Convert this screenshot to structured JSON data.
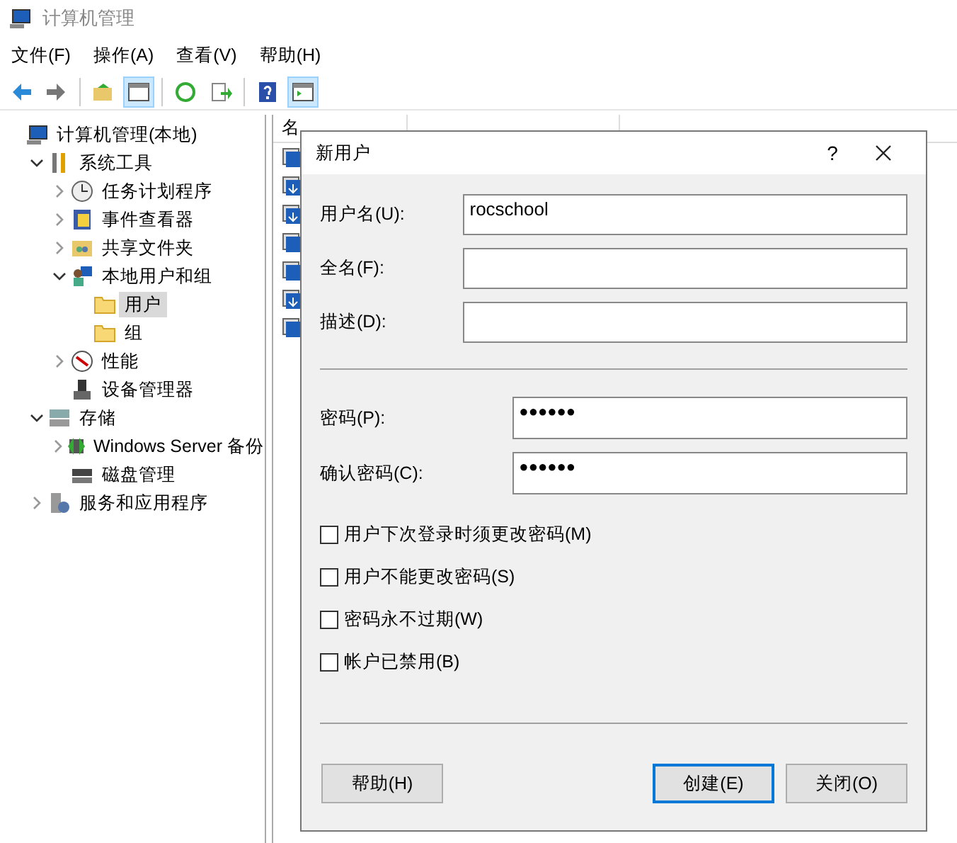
{
  "window": {
    "title": "计算机管理"
  },
  "menu": [
    "文件(F)",
    "操作(A)",
    "查看(V)",
    "帮助(H)"
  ],
  "toolbar": [
    {
      "pressed": false
    },
    {
      "pressed": false
    },
    {
      "pressed": false
    },
    {
      "pressed": true
    },
    {
      "pressed": false
    },
    {
      "pressed": false
    },
    {
      "pressed": false
    },
    {
      "pressed": true
    }
  ],
  "tree": [
    {
      "label": "计算机管理(本地)",
      "selected": false,
      "children": [
        {
          "label": "系统工具",
          "selected": false,
          "expanded": true,
          "children": [
            {
              "label": "任务计划程序",
              "selected": false,
              "expanded": false
            },
            {
              "label": "事件查看器",
              "selected": false,
              "expanded": false
            },
            {
              "label": "共享文件夹",
              "selected": false,
              "expanded": false
            },
            {
              "label": "本地用户和组",
              "selected": false,
              "expanded": true,
              "children": [
                {
                  "label": "用户",
                  "selected": true
                },
                {
                  "label": "组",
                  "selected": false
                }
              ]
            },
            {
              "label": "性能",
              "selected": false,
              "expanded": false
            },
            {
              "label": "设备管理器",
              "selected": false
            }
          ]
        },
        {
          "label": "存储",
          "selected": false,
          "expanded": true,
          "children": [
            {
              "label": "Windows Server 备份",
              "selected": false,
              "expanded": false
            },
            {
              "label": "磁盘管理",
              "selected": false
            }
          ]
        },
        {
          "label": "服务和应用程序",
          "selected": false,
          "expanded": false
        }
      ]
    }
  ],
  "list": {
    "column_1": "名",
    "rows": [
      {
        "kind": "user"
      },
      {
        "kind": "download"
      },
      {
        "kind": "download"
      },
      {
        "kind": "user"
      },
      {
        "kind": "user"
      },
      {
        "kind": "download"
      },
      {
        "kind": "user"
      }
    ]
  },
  "dialog": {
    "title": "新用户",
    "help_glyph": "?",
    "fields": [
      {
        "label": "用户名(U):",
        "value": "rocschool",
        "kind": "text"
      },
      {
        "label": "全名(F):",
        "kind": "text"
      },
      {
        "label": "描述(D):",
        "kind": "text"
      }
    ],
    "password_fields": [
      {
        "label": "密码(P):",
        "value": "●●●●●●"
      },
      {
        "label": "确认密码(C):",
        "value": "●●●●●●"
      }
    ],
    "options": [
      {
        "label": "用户下次登录时须更改密码(M)",
        "checked": false
      },
      {
        "label": "用户不能更改密码(S)",
        "checked": false
      },
      {
        "label": "密码永不过期(W)",
        "checked": false
      },
      {
        "label": "帐户已禁用(B)",
        "checked": false
      }
    ],
    "buttons": [
      {
        "label": "帮助(H)",
        "default": false
      },
      {
        "label": "创建(E)",
        "default": true
      },
      {
        "label": "关闭(O)",
        "default": false
      }
    ]
  }
}
